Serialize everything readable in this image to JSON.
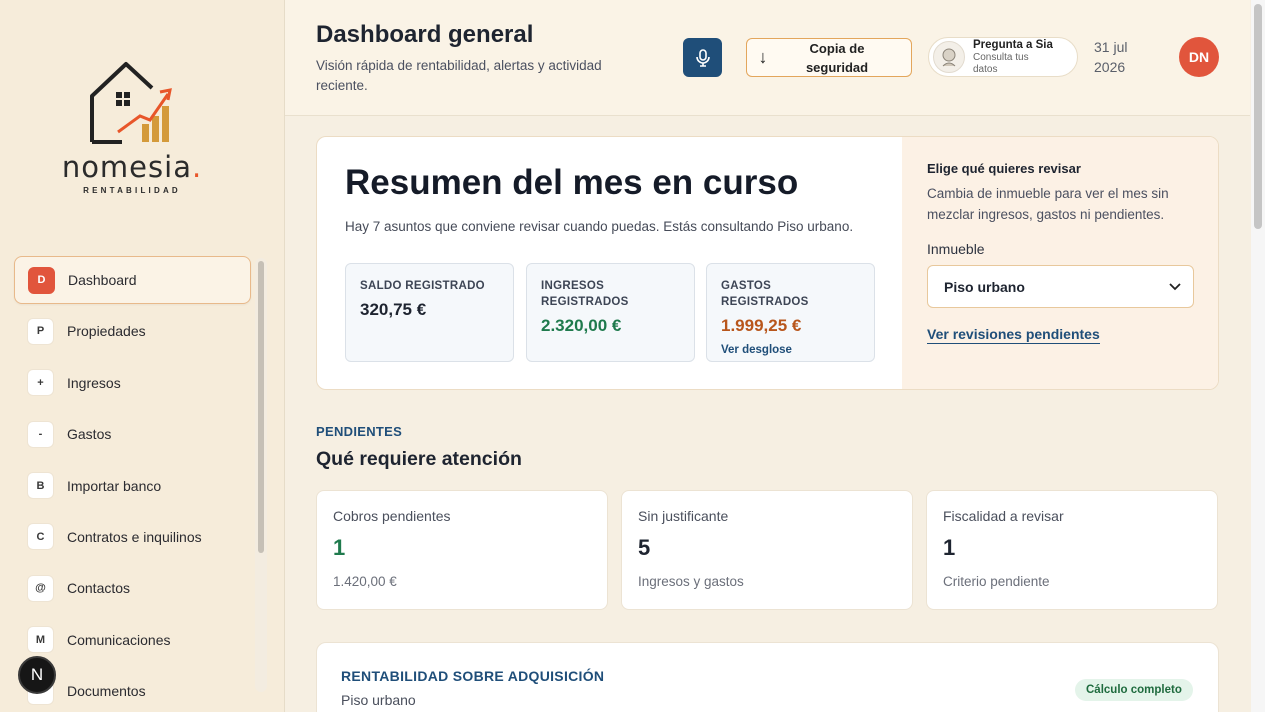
{
  "brand": {
    "name": "nomesia",
    "dot": ".",
    "tagline": "RENTABILIDAD"
  },
  "sidebar": {
    "items": [
      {
        "letter": "D",
        "label": "Dashboard",
        "active": true
      },
      {
        "letter": "P",
        "label": "Propiedades"
      },
      {
        "letter": "+",
        "label": "Ingresos"
      },
      {
        "letter": "-",
        "label": "Gastos"
      },
      {
        "letter": "B",
        "label": "Importar banco"
      },
      {
        "letter": "C",
        "label": "Contratos e inquilinos"
      },
      {
        "letter": "@",
        "label": "Contactos"
      },
      {
        "letter": "M",
        "label": "Comunicaciones"
      },
      {
        "letter": "",
        "label": "Documentos"
      }
    ],
    "floating_badge": "N"
  },
  "header": {
    "title": "Dashboard general",
    "subtitle": "Visión rápida de rentabilidad, alertas y actividad reciente.",
    "mic_icon": "microphone-icon",
    "backup_arrow": "↓",
    "backup_label": "Copia de seguridad",
    "sia_title": "Pregunta a Sia",
    "sia_sub": "Consulta tus datos",
    "date_line1": "31 jul",
    "date_line2": "2026",
    "avatar": "DN"
  },
  "summary": {
    "title": "Resumen del mes en curso",
    "text": "Hay 7 asuntos que conviene revisar cuando puedas. Estás consultando Piso urbano.",
    "stats": [
      {
        "label": "SALDO REGISTRADO",
        "value": "320,75 €",
        "color": "#1e2430"
      },
      {
        "label": "INGRESOS REGISTRADOS",
        "value": "2.320,00 €",
        "color": "#1f7a4d"
      },
      {
        "label": "GASTOS REGISTRADOS",
        "value": "1.999,25 €",
        "color": "#b8561c",
        "link": "Ver desglose"
      }
    ],
    "side": {
      "title": "Elige qué quieres revisar",
      "text": "Cambia de inmueble para ver el mes sin mezclar ingresos, gastos ni pendientes.",
      "select_label": "Inmueble",
      "select_value": "Piso urbano",
      "link": "Ver revisiones pendientes"
    }
  },
  "pending": {
    "kicker": "PENDIENTES",
    "title": "Qué requiere atención",
    "cards": [
      {
        "label": "Cobros pendientes",
        "count": "1",
        "sub": "1.420,00 €",
        "color": "#1f7a4d"
      },
      {
        "label": "Sin justificante",
        "count": "5",
        "sub": "Ingresos y gastos",
        "color": "#1e2430"
      },
      {
        "label": "Fiscalidad a revisar",
        "count": "1",
        "sub": "Criterio pendiente",
        "color": "#1e2430"
      }
    ]
  },
  "rentabilidad": {
    "kicker": "RENTABILIDAD SOBRE ADQUISICIÓN",
    "sub": "Piso urbano",
    "badge": "Cálculo completo"
  },
  "colors": {
    "accent": "#e1553c",
    "navy": "#1f4e79",
    "green": "#1f7a4d",
    "orange": "#b8561c"
  }
}
